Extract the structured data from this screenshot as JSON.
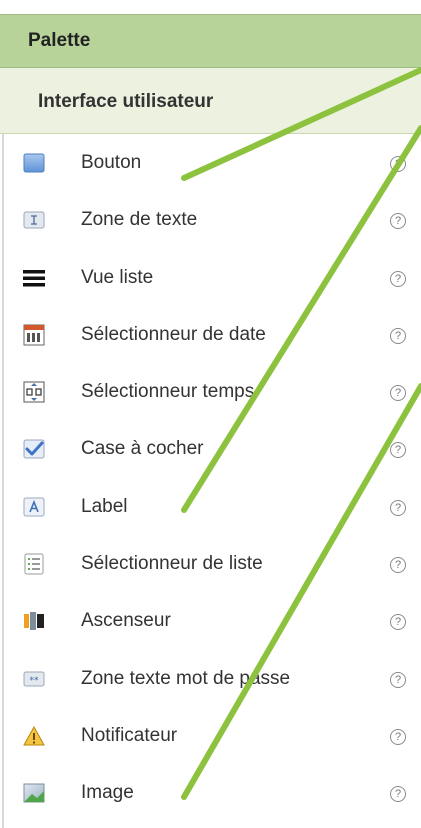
{
  "palette": {
    "title": "Palette"
  },
  "category": {
    "title": "Interface utilisateur"
  },
  "help_glyph": "?",
  "items": [
    {
      "label": "Bouton",
      "icon": "button-icon"
    },
    {
      "label": "Zone de texte",
      "icon": "textbox-icon"
    },
    {
      "label": "Vue liste",
      "icon": "listview-icon"
    },
    {
      "label": "Sélectionneur de date",
      "icon": "datepicker-icon"
    },
    {
      "label": "Sélectionneur temps",
      "icon": "timepicker-icon"
    },
    {
      "label": "Case à cocher",
      "icon": "checkbox-icon"
    },
    {
      "label": "Label",
      "icon": "label-icon"
    },
    {
      "label": "Sélectionneur de liste",
      "icon": "listpicker-icon"
    },
    {
      "label": "Ascenseur",
      "icon": "slider-icon"
    },
    {
      "label": "Zone texte mot de passe",
      "icon": "passwordtextbox-icon"
    },
    {
      "label": "Notificateur",
      "icon": "notifier-icon"
    },
    {
      "label": "Image",
      "icon": "image-icon"
    }
  ],
  "colors": {
    "palette_header": "#b7d39a",
    "category_header": "#ecf2df",
    "annotation_lines": "#8dc23f"
  }
}
